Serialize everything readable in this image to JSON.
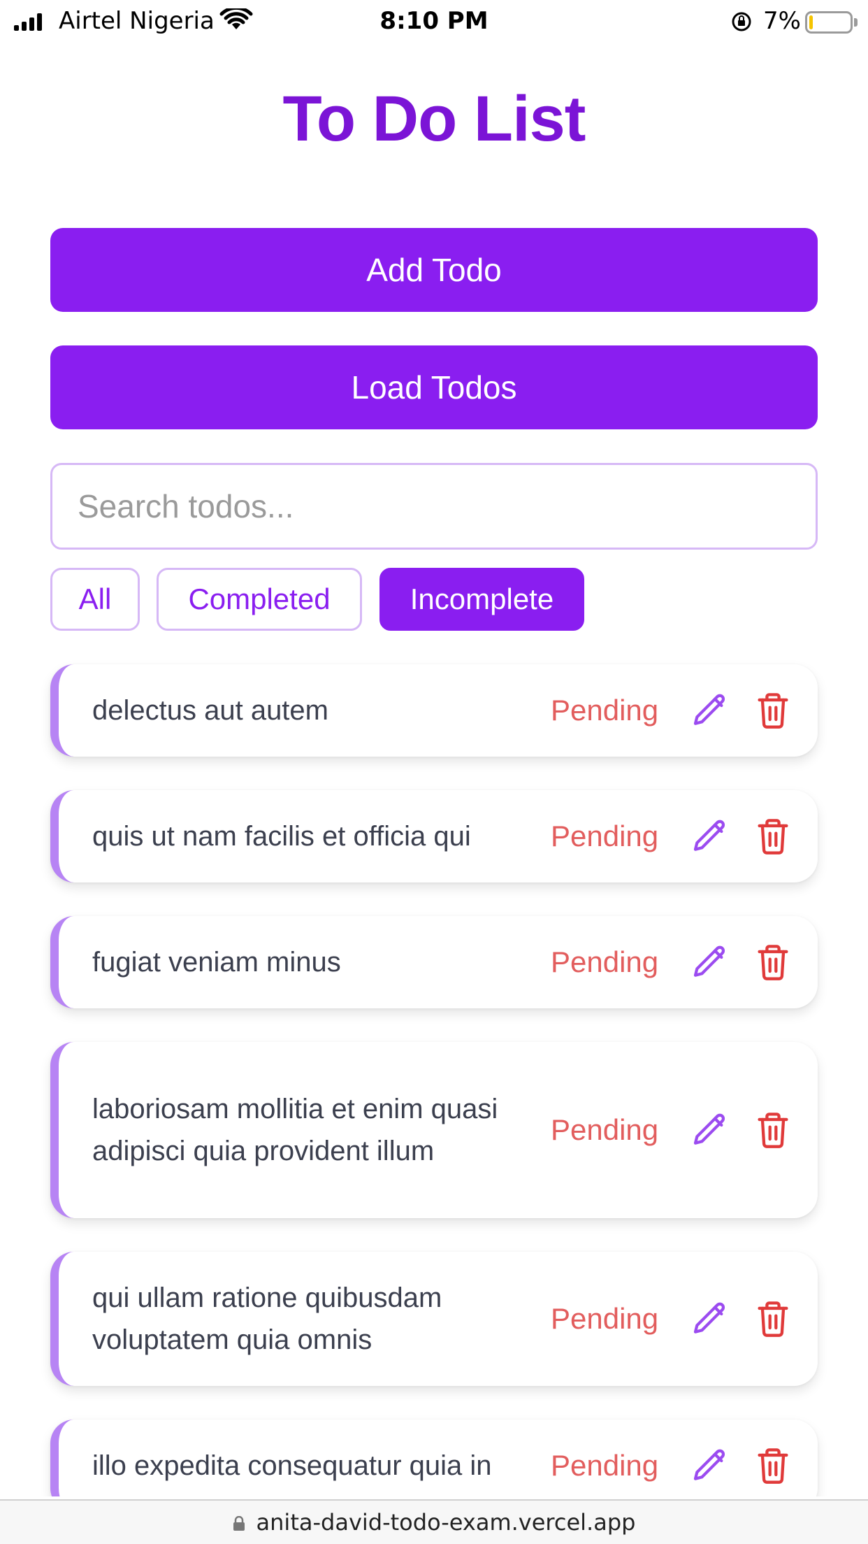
{
  "status_bar": {
    "carrier": "Airtel Nigeria",
    "time": "8:10 PM",
    "battery_percent": "7%"
  },
  "title": "To Do List",
  "actions": {
    "add_label": "Add Todo",
    "load_label": "Load Todos"
  },
  "search": {
    "placeholder": "Search todos...",
    "value": ""
  },
  "filters": [
    {
      "label": "All",
      "active": false
    },
    {
      "label": "Completed",
      "active": false
    },
    {
      "label": "Incomplete",
      "active": true
    }
  ],
  "todos": [
    {
      "text": "delectus aut autem",
      "status": "Pending"
    },
    {
      "text": "quis ut nam facilis et officia qui",
      "status": "Pending"
    },
    {
      "text": "fugiat veniam minus",
      "status": "Pending"
    },
    {
      "text": "laboriosam mollitia et enim quasi adipisci quia provident illum",
      "status": "Pending"
    },
    {
      "text": "qui ullam ratione quibusdam voluptatem quia omnis",
      "status": "Pending"
    },
    {
      "text": "illo expedita consequatur quia in",
      "status": "Pending"
    }
  ],
  "browser": {
    "url": "anita-david-todo-exam.vercel.app"
  },
  "colors": {
    "accent": "#8a1ef0",
    "title": "#7b14d6",
    "pending": "#e25d5d",
    "card_border": "#b784f4"
  }
}
